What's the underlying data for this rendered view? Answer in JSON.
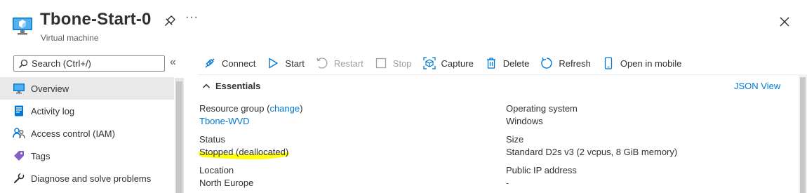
{
  "header": {
    "title": "Tbone-Start-0",
    "subtitle": "Virtual machine",
    "more_label": "···"
  },
  "search": {
    "placeholder": "Search (Ctrl+/)",
    "collapse_label": "«"
  },
  "sidebar": {
    "items": [
      {
        "label": "Overview",
        "icon": "monitor-icon"
      },
      {
        "label": "Activity log",
        "icon": "activity-log-icon"
      },
      {
        "label": "Access control (IAM)",
        "icon": "people-icon"
      },
      {
        "label": "Tags",
        "icon": "tag-icon"
      },
      {
        "label": "Diagnose and solve problems",
        "icon": "wrench-icon"
      }
    ]
  },
  "toolbar": {
    "connect": "Connect",
    "start": "Start",
    "restart": "Restart",
    "stop": "Stop",
    "capture": "Capture",
    "delete": "Delete",
    "refresh": "Refresh",
    "open_in_mobile": "Open in mobile"
  },
  "essentials": {
    "title": "Essentials",
    "json_view": "JSON View",
    "resource_group_label": "Resource group",
    "resource_group_change": "change",
    "resource_group_value": "Tbone-WVD",
    "status_label": "Status",
    "status_value": "Stopped (deallocated)",
    "location_label": "Location",
    "location_value": "North Europe",
    "os_label": "Operating system",
    "os_value": "Windows",
    "size_label": "Size",
    "size_value": "Standard D2s v3 (2 vcpus, 8 GiB memory)",
    "public_ip_label": "Public IP address",
    "public_ip_value": "-"
  },
  "colors": {
    "accent": "#0078d4",
    "highlight": "#ffff00",
    "active_nav": "#e9e9e9"
  }
}
